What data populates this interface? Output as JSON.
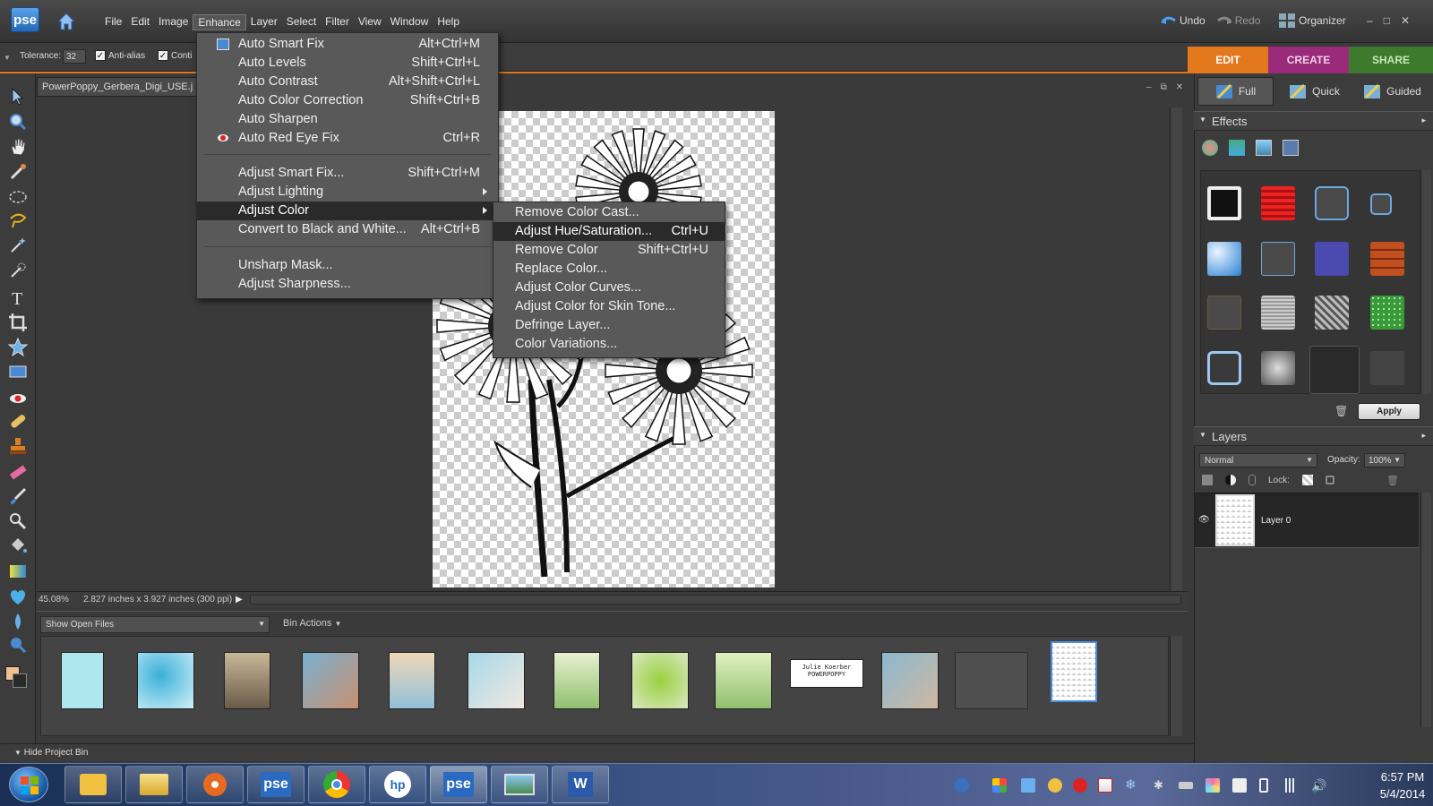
{
  "app": {
    "logo": "pse"
  },
  "menubar": [
    "File",
    "Edit",
    "Image",
    "Enhance",
    "Layer",
    "Select",
    "Filter",
    "View",
    "Window",
    "Help"
  ],
  "undo": "Undo",
  "redo": "Redo",
  "organizer": "Organizer",
  "options": {
    "tolerance_label": "Tolerance:",
    "tolerance_value": "32",
    "antialias": "Anti-alias",
    "contiguous": "Conti"
  },
  "workspace_tabs": {
    "edit": "EDIT",
    "create": "CREATE",
    "share": "SHARE"
  },
  "modes": {
    "full": "Full",
    "quick": "Quick",
    "guided": "Guided"
  },
  "document": {
    "tab_title": "PowerPoppy_Gerbera_Digi_USE.j",
    "zoom": "45.08%",
    "dimensions": "2.827 inches x 3.927 inches (300 ppi)"
  },
  "enhance_menu": [
    {
      "label": "Auto Smart Fix",
      "shortcut": "Alt+Ctrl+M"
    },
    {
      "label": "Auto Levels",
      "shortcut": "Shift+Ctrl+L"
    },
    {
      "label": "Auto Contrast",
      "shortcut": "Alt+Shift+Ctrl+L"
    },
    {
      "label": "Auto Color Correction",
      "shortcut": "Shift+Ctrl+B"
    },
    {
      "label": "Auto Sharpen",
      "shortcut": ""
    },
    {
      "label": "Auto Red Eye Fix",
      "shortcut": "Ctrl+R"
    },
    {
      "label": "Adjust Smart Fix...",
      "shortcut": "Shift+Ctrl+M"
    },
    {
      "label": "Adjust Lighting",
      "shortcut": ""
    },
    {
      "label": "Adjust Color",
      "shortcut": ""
    },
    {
      "label": "Convert to Black and White...",
      "shortcut": "Alt+Ctrl+B"
    },
    {
      "label": "Unsharp Mask...",
      "shortcut": ""
    },
    {
      "label": "Adjust Sharpness...",
      "shortcut": ""
    }
  ],
  "adjust_color_submenu": [
    {
      "label": "Remove Color Cast...",
      "shortcut": ""
    },
    {
      "label": "Adjust Hue/Saturation...",
      "shortcut": "Ctrl+U"
    },
    {
      "label": "Remove Color",
      "shortcut": "Shift+Ctrl+U"
    },
    {
      "label": "Replace Color...",
      "shortcut": ""
    },
    {
      "label": "Adjust Color Curves...",
      "shortcut": ""
    },
    {
      "label": "Adjust Color for Skin Tone...",
      "shortcut": ""
    },
    {
      "label": "Defringe Layer...",
      "shortcut": ""
    },
    {
      "label": "Color Variations...",
      "shortcut": ""
    }
  ],
  "bin": {
    "select": "Show Open Files",
    "actions": "Bin Actions",
    "hide": "Hide Project Bin",
    "thumb_text": "Julie Koerber POWERPOPPY"
  },
  "panels": {
    "effects": "Effects",
    "apply": "Apply",
    "layers": "Layers",
    "blend_mode": "Normal",
    "opacity_label": "Opacity:",
    "opacity_value": "100%",
    "lock_label": "Lock:",
    "layer_name": "Layer 0"
  },
  "taskbar": {
    "apps": [
      "outlook",
      "explorer",
      "media-player",
      "pse",
      "chrome",
      "hp",
      "pse",
      "photo-viewer",
      "word"
    ],
    "time": "6:57 PM",
    "date": "5/4/2014"
  },
  "colors": {
    "accent_orange": "#e3781c",
    "create_purple": "#9a2a7a",
    "share_green": "#3d7a2e"
  }
}
